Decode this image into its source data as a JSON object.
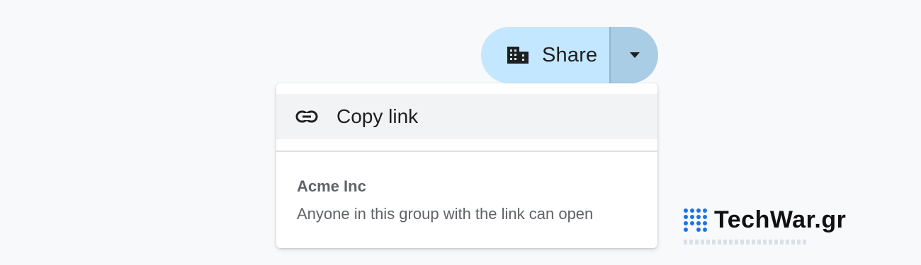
{
  "share_button": {
    "label": "Share",
    "icon": "building-icon",
    "dropdown_icon": "arrow-drop-down-icon"
  },
  "menu": {
    "copy_link": {
      "label": "Copy link",
      "icon": "link-icon"
    },
    "group": {
      "name": "Acme Inc",
      "description": "Anyone in this group with the link can open"
    }
  },
  "watermark": {
    "text": "TechWar.gr"
  },
  "colors": {
    "share_bg": "#c2e7ff",
    "dropdown_bg": "#a8cde4",
    "highlight_bg": "#f1f3f4",
    "watermark_accent": "#1a73e8"
  }
}
